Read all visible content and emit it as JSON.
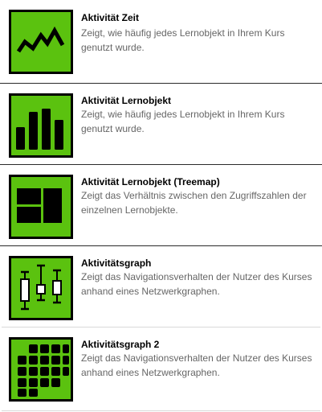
{
  "items": [
    {
      "title": "Aktivität Zeit",
      "description": "Zeigt, wie häufig jedes Lernobjekt in Ihrem Kurs genutzt wurde."
    },
    {
      "title": "Aktivität Lernobjekt",
      "description": "Zeigt, wie häufig jedes Lernobjekt in Ihrem Kurs genutzt wurde."
    },
    {
      "title": "Aktivität Lernobjekt (Treemap)",
      "description": "Zeigt das Verhältnis zwischen den Zugriffszahlen der einzelnen Lernobjekte."
    },
    {
      "title": "Aktivitätsgraph",
      "description": "Zeigt das Navigationsverhalten der Nutzer des Kurses anhand eines Netzwerkgraphen."
    },
    {
      "title": "Aktivitätsgraph 2",
      "description": "Zeigt das Navigationsverhalten der Nutzer des Kurses anhand eines Netzwerkgraphen."
    }
  ],
  "colors": {
    "icon_fill": "#5bc20f",
    "icon_border": "#000000",
    "title": "#000000",
    "description": "#666666",
    "separator": "#2a2a2a"
  },
  "icons": [
    "line-chart-icon",
    "bar-chart-icon",
    "treemap-icon",
    "boxplot-icon",
    "grid-icon"
  ]
}
